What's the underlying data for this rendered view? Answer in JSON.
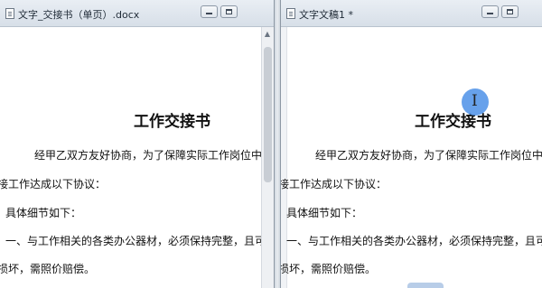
{
  "left_window": {
    "title": "文字_交接书（单页）.docx",
    "heading": "工作交接书",
    "lines": [
      "经甲乙双方友好协商，为了保障实际工作岗位中",
      "接工作达成以下协议：",
      "具体细节如下：",
      "一、与工作相关的各类办公器材，必须保持完整，且可",
      "损坏，需照价赔偿。"
    ]
  },
  "right_window": {
    "title": "文字文稿1 *",
    "heading": "工作交接书",
    "lines": [
      "经甲乙双方友好协商，为了保障实际工作岗位中",
      "接工作达成以下协议：",
      "具体细节如下：",
      "一、与工作相关的各类办公器材，必须保持完整，且可",
      "损坏，需照价赔偿。"
    ]
  },
  "cursor": {
    "glyph": "I",
    "color": "#4c90e8"
  },
  "scroll": {
    "up_arrow": "▲"
  }
}
